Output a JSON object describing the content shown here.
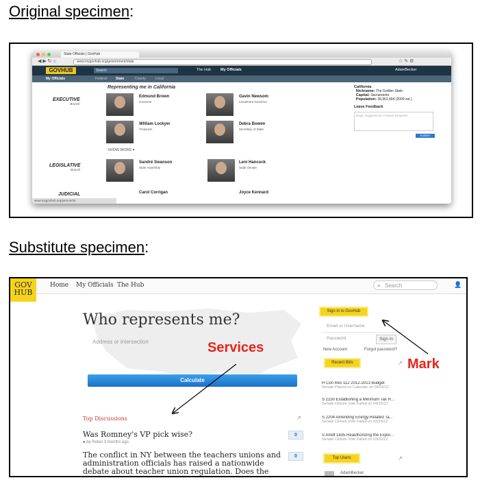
{
  "headings": {
    "original": "Original specimen",
    "substitute": "Substitute specimen",
    "colon": ":"
  },
  "original": {
    "tab_title": "State Officials | GovHub",
    "url": "www.mygovhub.org/government/state",
    "logo": "GOVHUB",
    "search_placeholder": "Search",
    "nav": [
      "The Hub",
      "My Officials"
    ],
    "user": "AdamBecker",
    "subnav": [
      "My Officials",
      "Federal",
      "State",
      "County",
      "Local"
    ],
    "subnav_active": "State",
    "section_title": "Representing me in California",
    "branches": [
      {
        "name": "EXECUTIVE",
        "sub": "Branch"
      },
      {
        "name": "LEGISLATIVE",
        "sub": "Branch"
      },
      {
        "name": "JUDICIAL",
        "sub": ""
      }
    ],
    "officials": [
      {
        "name": "Edmund Brown",
        "role": "Governor"
      },
      {
        "name": "Gavin Newsom",
        "role": "Lieutenant Governor"
      },
      {
        "name": "William Lockyer",
        "role": "Treasurer"
      },
      {
        "name": "Debra Bowen",
        "role": "Secretary of State"
      },
      {
        "name": "Sandré Swanson",
        "role": "State Assembly"
      },
      {
        "name": "Leni Hancock",
        "role": "State Senate"
      },
      {
        "name": "Carol Corrigan",
        "role": ""
      },
      {
        "name": "Joyce Kennard",
        "role": ""
      }
    ],
    "show_more": "SHOW MORE",
    "sidebar": {
      "state": "California",
      "nickname_label": "Nickname:",
      "nickname": "The Golden State",
      "capital_label": "Capital:",
      "capital": "Sacramento",
      "population_label": "Population:",
      "population": "36,961,664 (2009 est.)",
      "feedback_title": "Leave Feedback",
      "feedback_placeholder": "Bugs, Suggestions, Feature Requests",
      "submit": "SUBMIT"
    },
    "status_url": "www.mygovhub.org/person/42"
  },
  "substitute": {
    "logo_line1": "GOV",
    "logo_line2": "HUB",
    "nav": [
      "Home",
      "My Officials",
      "The Hub"
    ],
    "search_placeholder": "Search",
    "headline": "Who represents me?",
    "address_placeholder": "Address or intersection",
    "calculate": "Calculate",
    "top_discussions": "Top Discussions",
    "discussions": [
      {
        "title": "Was Romney's VP pick wise?",
        "meta_user": "Rebel",
        "meta_time": "3 months ago",
        "count": "0"
      },
      {
        "title": "The conflict in NY between the teachers unions and administration officials has raised a nationwide debate about teacher union regulation. Does the current system need reform?",
        "count": "0"
      }
    ],
    "sign_in": "Sign in to GovHub",
    "email_placeholder": "Email or Username",
    "password_placeholder": "Password",
    "sign_in_button": "Sign in",
    "new_account": "New Account",
    "forgot": "Forgot password?",
    "recent_bills": "Recent Bills",
    "bills": [
      {
        "title": "H Con Res 112 2012-2013 Budget",
        "status": "Senate Placed on Calendar on 04/16/12"
      },
      {
        "title": "S 2230 Establishing a Minimum Tax R...",
        "status": "Senate Cloture Vote Failed on 04/16/12"
      },
      {
        "title": "S 2204 Amending Energy-Related Ta...",
        "status": "Senate Cloture Vote Failed on 03/29/12"
      },
      {
        "title": "S Amdt 1835 Reauthorizing the Expor...",
        "status": "Senate Cloture Vote Failed on 03/20/12"
      }
    ],
    "top_users": "Top Users",
    "top_user_name": "AdamBecker",
    "annotations": {
      "services": "Services",
      "mark": "Mark"
    },
    "colors": {
      "annotation": "#e8231b",
      "logo": "#f6d31c",
      "button": "#1b70c8"
    }
  }
}
